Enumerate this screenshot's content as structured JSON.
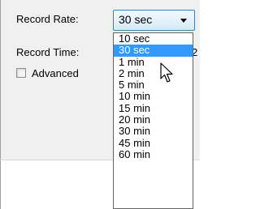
{
  "record_rate": {
    "label": "Record Rate:",
    "value": "30 sec"
  },
  "record_time": {
    "label": "Record Time:",
    "value_fragment": "2"
  },
  "advanced": {
    "label": "Advanced",
    "checked": false
  },
  "dropdown": {
    "options": [
      "10 sec",
      "30 sec",
      "1 min",
      "2 min",
      "5 min",
      "10 min",
      "15 min",
      "20 min",
      "30 min",
      "45 min",
      "60 min"
    ],
    "highlighted": "30 sec"
  },
  "colors": {
    "highlight": "#3399ff",
    "panel": "#f0f0f0",
    "combo_border": "#3c7fb1"
  },
  "icons": {
    "cursor": "arrow-cursor-icon",
    "combo_arrow": "chevron-down-icon"
  }
}
